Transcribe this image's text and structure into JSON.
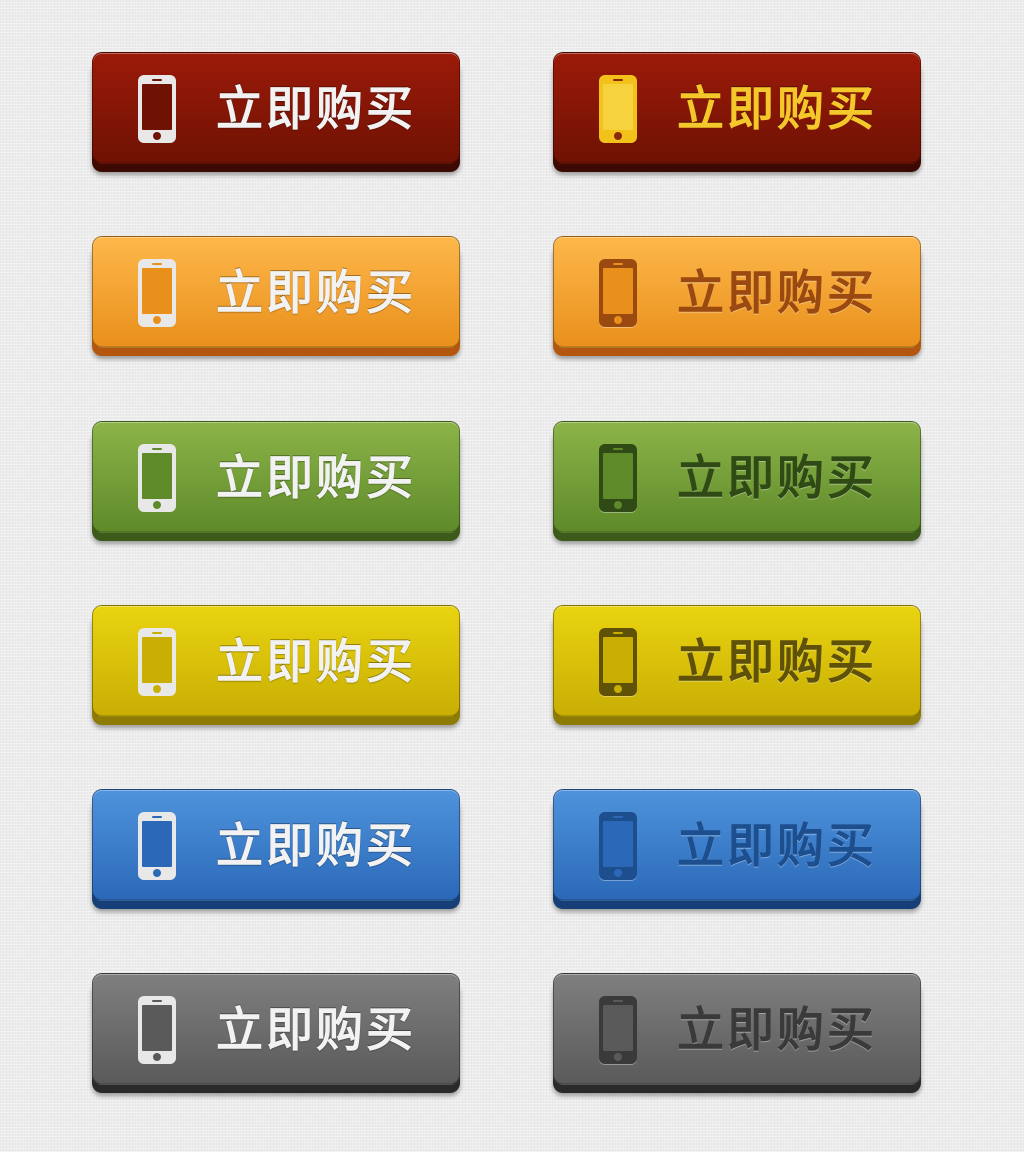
{
  "button_label": "立即购买",
  "buttons": [
    {
      "label": "立即购买",
      "color": "red",
      "style": "light",
      "top_color": "#9c1a09",
      "bottom_color": "#6f1204",
      "base_color": "#3d0a03",
      "icon": "phone-icon"
    },
    {
      "label": "立即购买",
      "color": "red",
      "style": "gold",
      "top_color": "#9c1a09",
      "bottom_color": "#6f1204",
      "base_color": "#3d0a03",
      "icon": "phone-icon"
    },
    {
      "label": "立即购买",
      "color": "orange",
      "style": "light",
      "top_color": "#fdb74a",
      "bottom_color": "#e9901c",
      "base_color": "#b5560e",
      "icon": "phone-icon"
    },
    {
      "label": "立即购买",
      "color": "orange",
      "style": "dark",
      "top_color": "#fdb74a",
      "bottom_color": "#e9901c",
      "base_color": "#b5560e",
      "icon_color": "#9a4a10",
      "icon": "phone-icon"
    },
    {
      "label": "立即购买",
      "color": "green",
      "style": "light",
      "top_color": "#8bb448",
      "bottom_color": "#5f8a2a",
      "base_color": "#3c5a19",
      "icon": "phone-icon"
    },
    {
      "label": "立即购买",
      "color": "green",
      "style": "dark",
      "top_color": "#8bb448",
      "bottom_color": "#5f8a2a",
      "base_color": "#3c5a19",
      "icon_color": "#2f4a14",
      "icon": "phone-icon"
    },
    {
      "label": "立即购买",
      "color": "yellow",
      "style": "light",
      "top_color": "#e9d410",
      "bottom_color": "#c9ae04",
      "base_color": "#8e7b05",
      "icon": "phone-icon"
    },
    {
      "label": "立即购买",
      "color": "yellow",
      "style": "dark",
      "top_color": "#e9d410",
      "bottom_color": "#c9ae04",
      "base_color": "#8e7b05",
      "icon_color": "#5f5208",
      "icon": "phone-icon"
    },
    {
      "label": "立即购买",
      "color": "blue",
      "style": "light",
      "top_color": "#4e93dc",
      "bottom_color": "#2b69b8",
      "base_color": "#163f78",
      "icon": "phone-icon"
    },
    {
      "label": "立即购买",
      "color": "blue",
      "style": "dark",
      "top_color": "#4e93dc",
      "bottom_color": "#2b69b8",
      "base_color": "#163f78",
      "icon_color": "#1d4f8f",
      "icon": "phone-icon"
    },
    {
      "label": "立即购买",
      "color": "gray",
      "style": "light",
      "top_color": "#7f7f7f",
      "bottom_color": "#5a5a5a",
      "base_color": "#2a2a2a",
      "icon": "phone-icon"
    },
    {
      "label": "立即购买",
      "color": "gray",
      "style": "dark",
      "top_color": "#7f7f7f",
      "bottom_color": "#5a5a5a",
      "base_color": "#2a2a2a",
      "icon_color": "#3a3a3a",
      "icon": "phone-icon"
    }
  ]
}
